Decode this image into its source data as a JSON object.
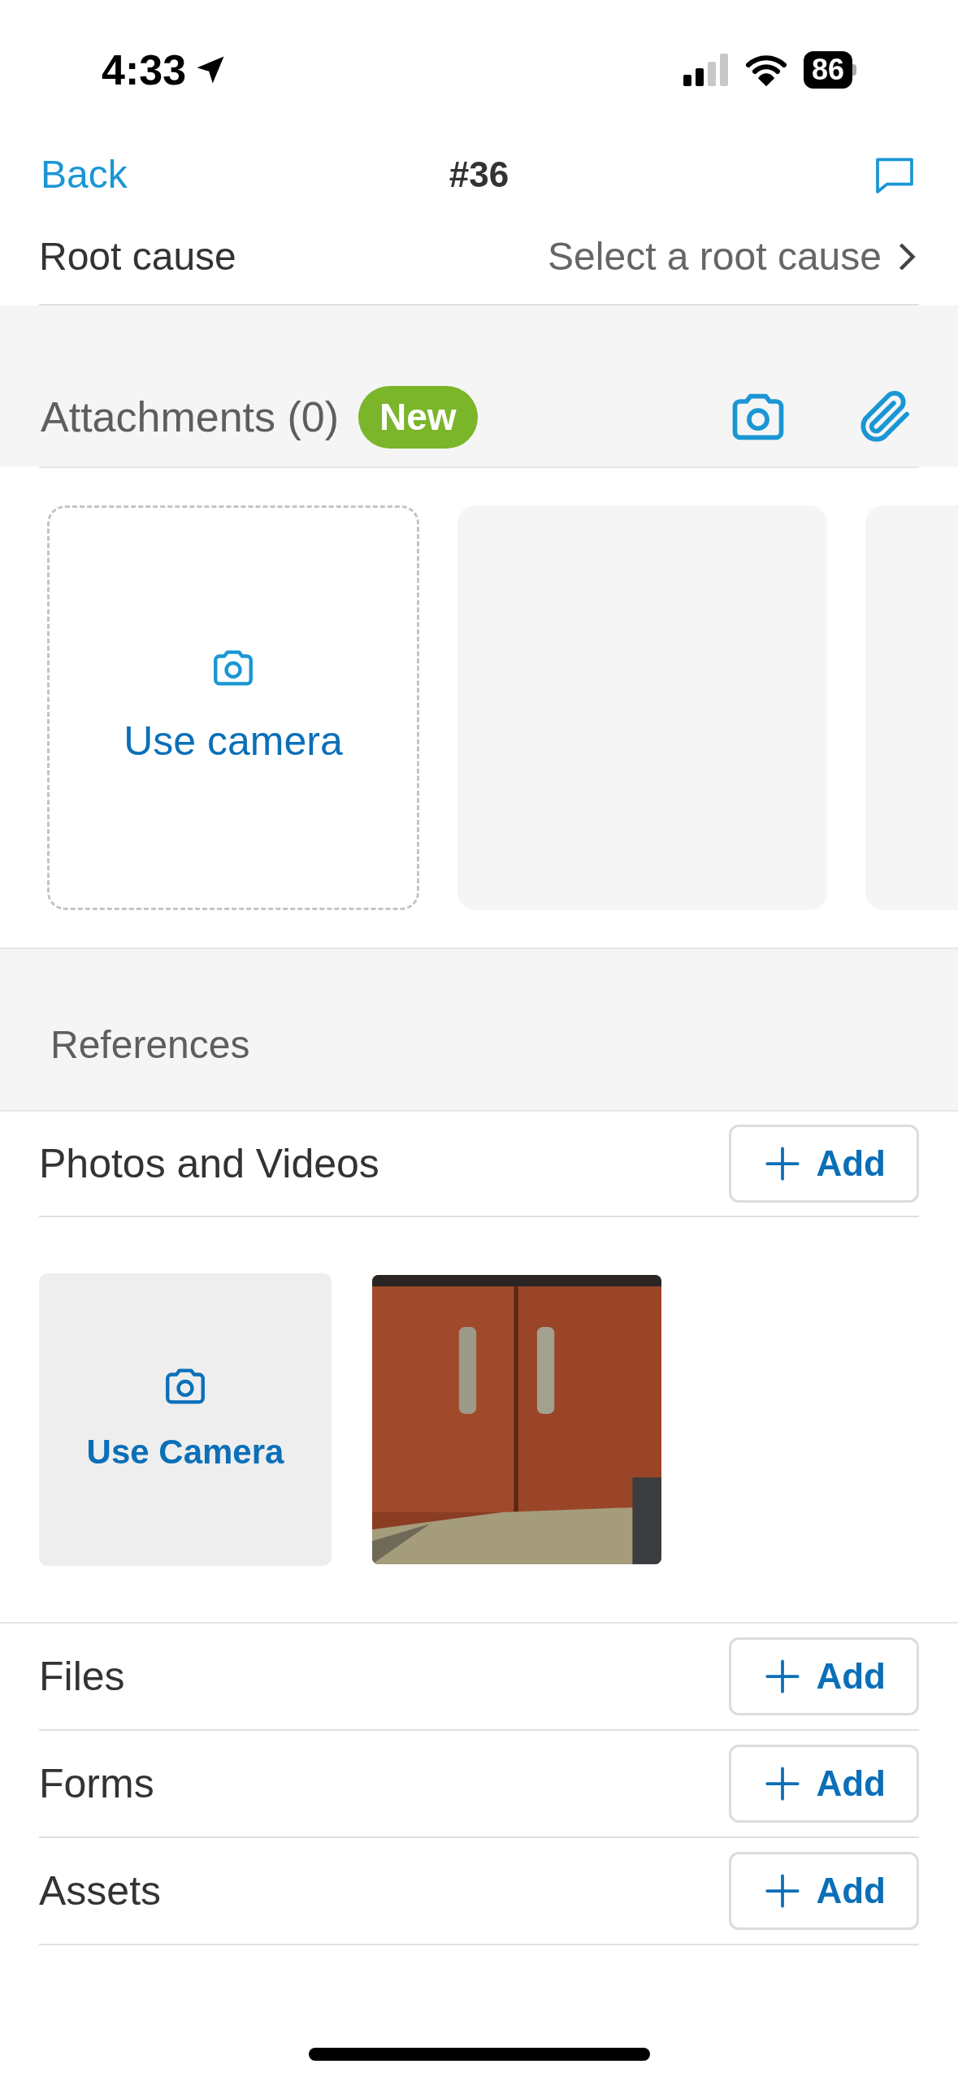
{
  "status_bar": {
    "time": "4:33",
    "battery": "86"
  },
  "nav": {
    "back": "Back",
    "title": "#36"
  },
  "root_cause": {
    "label": "Root cause",
    "value": "Select a root cause"
  },
  "attachments": {
    "title": "Attachments (0)",
    "badge": "New",
    "camera_tile": "Use camera",
    "tiles": [
      {
        "kind": "placeholder"
      },
      {
        "kind": "placeholder"
      }
    ]
  },
  "references": {
    "title": "References",
    "photos": {
      "label": "Photos and Videos",
      "button": "Add",
      "camera_tile": "Use Camera"
    },
    "rows": [
      {
        "label": "Files",
        "button": "Add"
      },
      {
        "label": "Forms",
        "button": "Add"
      },
      {
        "label": "Assets",
        "button": "Add"
      }
    ]
  }
}
